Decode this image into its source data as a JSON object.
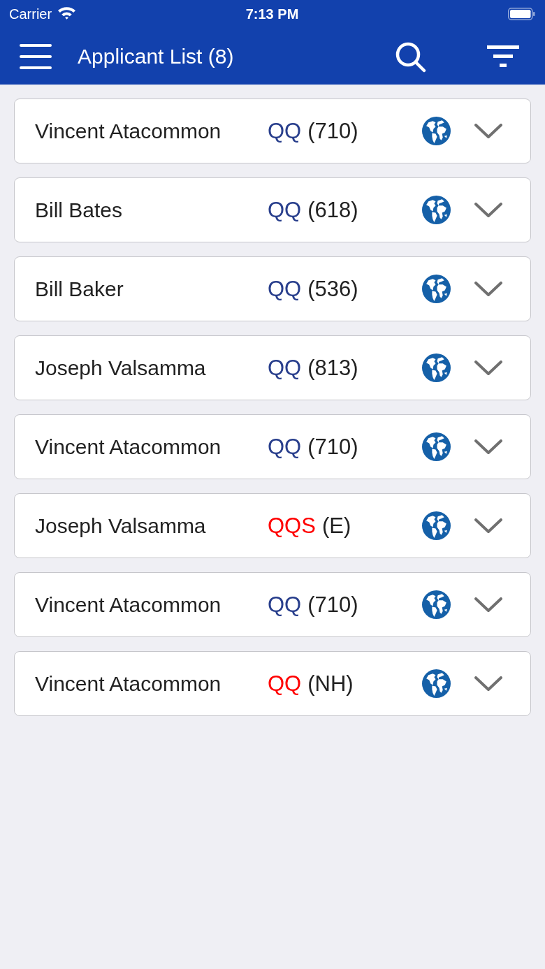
{
  "status_bar": {
    "carrier": "Carrier",
    "time": "7:13 PM"
  },
  "header": {
    "title": "Applicant List (8)"
  },
  "applicants": [
    {
      "name": "Vincent Atacommon",
      "code": "QQ",
      "color": "#283e8c",
      "score": "(710)",
      "expanded": false
    },
    {
      "name": "Bill Bates",
      "code": "QQ",
      "color": "#283e8c",
      "score": "(618)",
      "expanded": false
    },
    {
      "name": "Bill Baker",
      "code": "QQ",
      "color": "#283e8c",
      "score": "(536)",
      "expanded": false
    },
    {
      "name": "Joseph Valsamma",
      "code": "QQ",
      "color": "#283e8c",
      "score": "(813)",
      "expanded": false
    },
    {
      "name": "Vincent Atacommon",
      "code": "QQ",
      "color": "#283e8c",
      "score": "(710)",
      "expanded": false
    },
    {
      "name": "Joseph Valsamma",
      "code": "QQS",
      "color": "#ff0000",
      "score": "(E)",
      "expanded": false
    },
    {
      "name": "Vincent Atacommon",
      "code": "QQ",
      "color": "#283e8c",
      "score": "(710)",
      "expanded": false
    },
    {
      "name": "Vincent Atacommon",
      "code": "QQ",
      "color": "#ff0000",
      "score": "(NH)",
      "expanded": false
    }
  ]
}
